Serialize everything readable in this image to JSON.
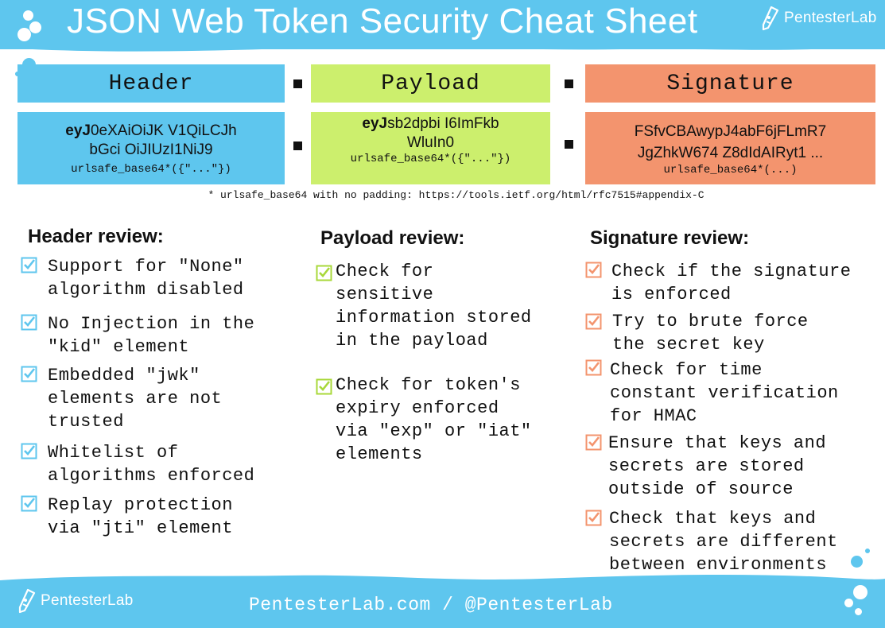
{
  "title": "JSON Web Token Security Cheat Sheet",
  "brand": {
    "name": "PentesterLab"
  },
  "parts": {
    "header": {
      "label": "Header",
      "token_bold": "eyJ",
      "token_line1": "0eXAiOiJK V1QiLCJh",
      "token_line2": "bGci OiJIUzI1NiJ9",
      "encoding": "urlsafe_base64*({\"...\"})"
    },
    "payload": {
      "label": "Payload",
      "token_bold": "eyJ",
      "token_line1": "sb2dpbi I6ImFkb",
      "token_line2": "WluIn0",
      "encoding": "urlsafe_base64*({\"...\"})"
    },
    "signature": {
      "label": "Signature",
      "token_line1": "FSfvCBAwypJ4abF6jFLmR7",
      "token_line2": "JgZhkW674 Z8dIdAIRyt1 ...",
      "encoding": "urlsafe_base64*(...)"
    }
  },
  "footnote": "* urlsafe_base64 with no padding: https://tools.ietf.org/html/rfc7515#appendix-C",
  "header_review": {
    "title": "Header review:",
    "items": [
      {
        "line1": "Support for \"None\"",
        "line2": "algorithm disabled"
      },
      {
        "line1": "No Injection in the",
        "line2": "\"kid\" element"
      },
      {
        "line1": "Embedded \"jwk\"",
        "line2": "elements are not",
        "line3": "trusted"
      },
      {
        "line1": "Whitelist of",
        "line2": "algorithms enforced"
      },
      {
        "line1": "Replay protection",
        "line2": "via \"jti\" element"
      }
    ]
  },
  "payload_review": {
    "title": "Payload review:",
    "items": [
      {
        "line1": "Check for",
        "line2": "sensitive",
        "line3": "information stored",
        "line4": "in the payload"
      },
      {
        "line1": "Check for token's",
        "line2": "expiry enforced",
        "line3": "via \"exp\" or \"iat\"",
        "line4": "elements"
      }
    ]
  },
  "signature_review": {
    "title": "Signature review:",
    "items": [
      {
        "line1": "Check if the signature",
        "line2": "is enforced"
      },
      {
        "line1": "Try to brute force",
        "line2": "the secret key"
      },
      {
        "line1": "Check for time",
        "line2": "constant verification",
        "line3": "for HMAC"
      },
      {
        "line1": "Ensure that keys and",
        "line2": "secrets are stored",
        "line3": "outside of source"
      },
      {
        "line1": "Check that keys and",
        "line2": "secrets are different",
        "line3": "between environments"
      }
    ]
  },
  "footer": {
    "text": "PentesterLab.com / @PentesterLab"
  },
  "colors": {
    "header": "#5ec6ee",
    "payload": "#ccef6d",
    "signature": "#f3946e",
    "banner": "#5ec6ee"
  },
  "icons": {
    "checkbox": "checkbox-checked-icon",
    "logo": "pen-flask-icon"
  }
}
